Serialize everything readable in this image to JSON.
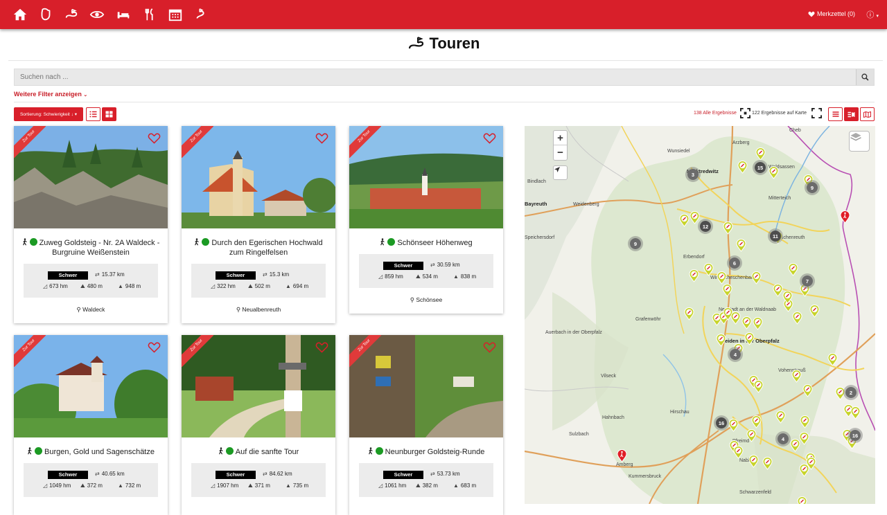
{
  "nav": {
    "icons": [
      "home-icon",
      "hand-icon",
      "tour-icon",
      "eye-icon",
      "bed-icon",
      "cutlery-icon",
      "calendar-icon",
      "event-icon"
    ],
    "merkzettel": "Merkzettel (0)"
  },
  "page": {
    "title": "Touren"
  },
  "search": {
    "placeholder": "Suchen nach ..."
  },
  "filters": {
    "more": "Weitere Filter anzeigen"
  },
  "toolbar": {
    "sort": "Sortierung: Schwierigkeit",
    "results_all": "138 Alle Ergebnisse",
    "results_map": "122 Ergebnisse auf Karte"
  },
  "cards": [
    {
      "title": "Zuweg Goldsteig - Nr. 2A Waldeck - Burgruine Weißenstein",
      "difficulty": "Schwer",
      "distance": "15.37 km",
      "duration": "673 hm",
      "ascent": "480 m",
      "max": "948 m",
      "location": "Waldeck",
      "ribbon": "Zur Tour",
      "scene": "rocks"
    },
    {
      "title": "Durch den Egerischen Hochwald zum Ringelfelsen",
      "difficulty": "Schwer",
      "distance": "15.3 km",
      "duration": "322 hm",
      "ascent": "502 m",
      "max": "694 m",
      "location": "Neualbenreuth",
      "ribbon": "Zur Tour",
      "scene": "church"
    },
    {
      "title": "Schönseer Höhenweg",
      "difficulty": "Schwer",
      "distance": "30.59 km",
      "duration": "859 hm",
      "ascent": "534 m",
      "max": "838 m",
      "location": "Schönsee",
      "ribbon": "Zur Tour",
      "scene": "village"
    },
    {
      "title": "Burgen, Gold und Sagenschätze",
      "difficulty": "Schwer",
      "distance": "40.65 km",
      "duration": "1049 hm",
      "ascent": "372 m",
      "max": "732 m",
      "location": "",
      "ribbon": "Zur Tour",
      "scene": "castle"
    },
    {
      "title": "Auf die sanfte Tour",
      "difficulty": "Schwer",
      "distance": "84.62 km",
      "duration": "1907 hm",
      "ascent": "371 m",
      "max": "735 m",
      "location": "",
      "ribbon": "Zur Tour",
      "scene": "path"
    },
    {
      "title": "Neunburger Goldsteig-Runde",
      "difficulty": "Schwer",
      "distance": "53.73 km",
      "duration": "1061 hm",
      "ascent": "382 m",
      "max": "683 m",
      "location": "",
      "ribbon": "Zur Tour",
      "scene": "forest"
    }
  ],
  "map": {
    "labels": [
      "Cheb",
      "Wunsiedel",
      "Marktredwitz",
      "Waldsassen",
      "Bindlach",
      "Bayreuth",
      "Weidenberg",
      "Mitterteich",
      "Speichersdorf",
      "Tirschenreuth",
      "Erbendorf",
      "Windischeschenbach",
      "Neustadt an der Waldnaab",
      "Grafenwöhr",
      "Auerbach in der Oberpfalz",
      "Weiden in der Oberpfalz",
      "Vilseck",
      "Vohenstrauß",
      "Hirschau",
      "Hahnbach",
      "Sulzbach",
      "Amberg",
      "Kummersbruck",
      "Pfreimd",
      "Nabburg",
      "Schwarzenfeld",
      "Arzberg"
    ],
    "clusters": [
      "15",
      "3",
      "9",
      "12",
      "9",
      "11",
      "6",
      "7",
      "4",
      "2",
      "16",
      "4",
      "16"
    ]
  }
}
